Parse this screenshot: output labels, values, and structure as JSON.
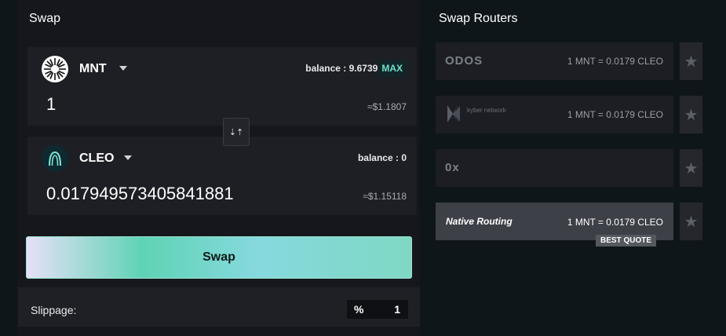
{
  "swap": {
    "title": "Swap",
    "from": {
      "symbol": "MNT",
      "balance": "balance : 9.67393",
      "max_label": "MAX",
      "amount": "1",
      "usd": "≈$1.1807",
      "icon": "mnt-token-icon"
    },
    "to": {
      "symbol": "CLEO",
      "balance": "balance : 0",
      "amount": "0.017949573405841881",
      "usd": "≈$1.15118",
      "icon": "cleo-token-icon"
    },
    "switch_icon": "swap-direction-icon",
    "swap_button": "Swap",
    "slippage": {
      "label": "Slippage:",
      "unit": "%",
      "value": "1"
    }
  },
  "routers": {
    "title": "Swap Routers",
    "items": [
      {
        "name": "ODOS",
        "quote": "1 MNT = 0.0179 CLEO",
        "best": false
      },
      {
        "name": "kyber network",
        "quote": "1 MNT = 0.0179 CLEO",
        "best": false
      },
      {
        "name": "0x",
        "quote": "",
        "best": false
      },
      {
        "name": "Native Routing",
        "quote": "1 MNT = 0.0179 CLEO",
        "best": true
      }
    ],
    "best_badge": "BEST QUOTE",
    "star_icon": "star-icon"
  },
  "colors": {
    "background": "#0f161a",
    "panel": "#15171c",
    "accent": "#6fe0c8",
    "swap_gradient_start": "#e6e0f8",
    "swap_gradient_end": "#7fd8c3"
  }
}
